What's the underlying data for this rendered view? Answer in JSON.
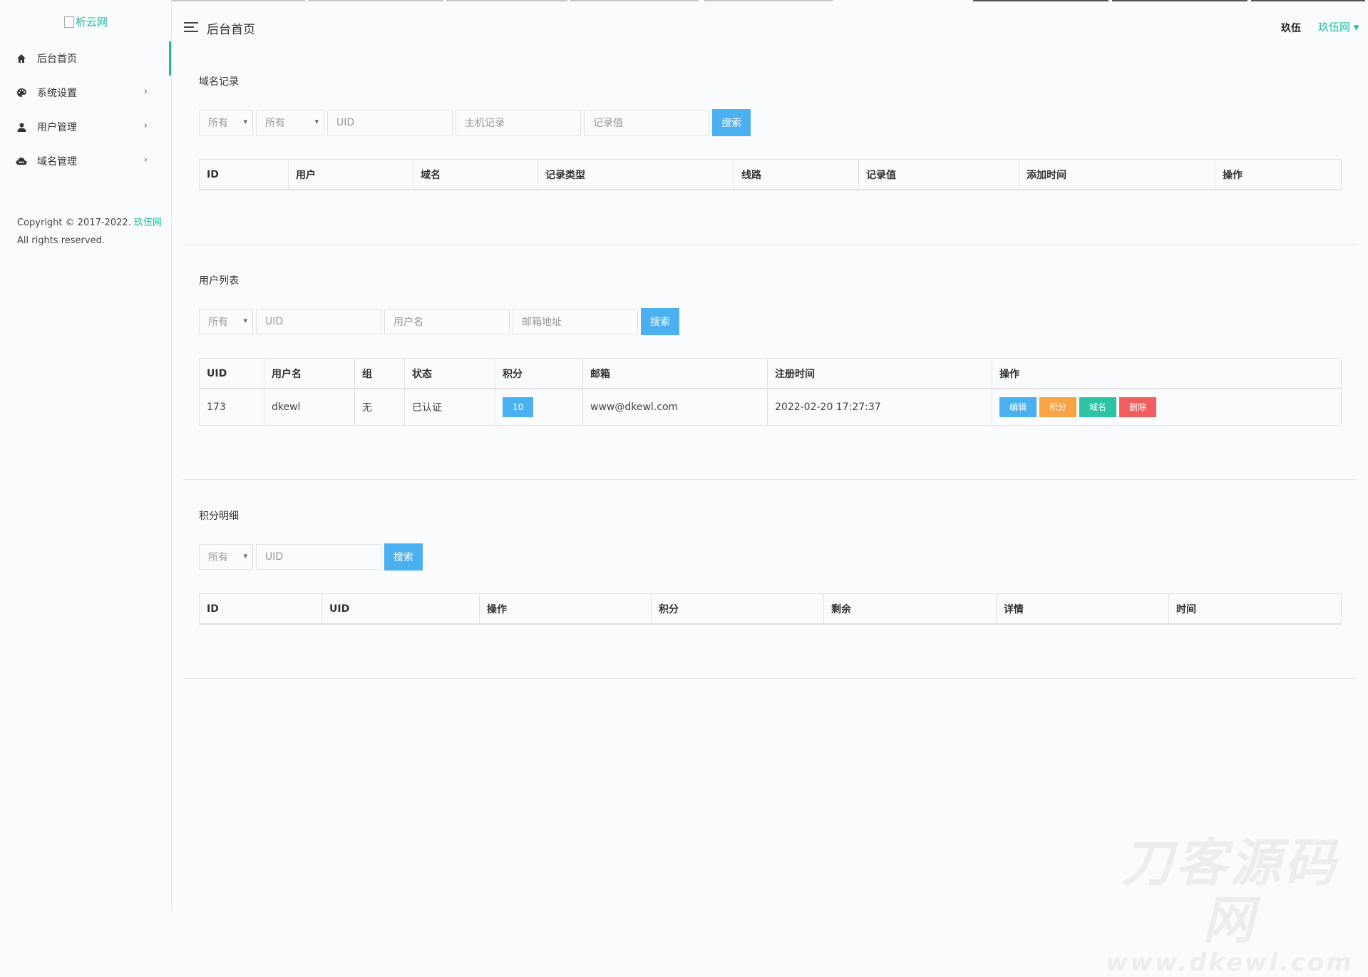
{
  "sidebar": {
    "logo_text": "析云网",
    "items": [
      {
        "label": "后台首页"
      },
      {
        "label": "系统设置"
      },
      {
        "label": "用户管理"
      },
      {
        "label": "域名管理"
      }
    ],
    "copyright_prefix": "Copyright © 2017-2022. ",
    "copyright_brand": "玖伍网",
    "copyright_suffix": "All rights reserved."
  },
  "header": {
    "title": "后台首页",
    "user_primary": "玖伍",
    "user_secondary": "玖伍网 ▾"
  },
  "domain_records": {
    "title": "域名记录",
    "filters": {
      "select1": "所有",
      "select2": "所有",
      "uid": "UID",
      "host": "主机记录",
      "value": "记录值"
    },
    "search_label": "搜索",
    "columns": [
      "ID",
      "用户",
      "域名",
      "记录类型",
      "线路",
      "记录值",
      "添加时间",
      "操作"
    ]
  },
  "user_list": {
    "title": "用户列表",
    "filters": {
      "select1": "所有",
      "uid": "UID",
      "username": "用户名",
      "email": "邮箱地址"
    },
    "search_label": "搜索",
    "columns": [
      "UID",
      "用户名",
      "组",
      "状态",
      "积分",
      "邮箱",
      "注册时间",
      "操作"
    ],
    "rows": [
      {
        "uid": "173",
        "username": "dkewl",
        "group": "无",
        "status": "已认证",
        "points": "10",
        "email": "www@dkewl.com",
        "reg_time": "2022-02-20 17:27:37",
        "actions": {
          "edit": "编辑",
          "points": "积分",
          "domain": "域名",
          "delete": "删除"
        }
      }
    ]
  },
  "points_detail": {
    "title": "积分明细",
    "filters": {
      "select1": "所有",
      "uid": "UID"
    },
    "search_label": "搜索",
    "columns": [
      "ID",
      "UID",
      "操作",
      "积分",
      "剩余",
      "详情",
      "时间"
    ]
  },
  "watermark": {
    "line1": "刀客源码网",
    "line2": "www.dkewl.com"
  },
  "colors": {
    "accent": "#1abc9c",
    "primary": "#4ab0f0",
    "warning": "#f7a445",
    "success": "#2ec3a4",
    "danger": "#f15e5e"
  }
}
